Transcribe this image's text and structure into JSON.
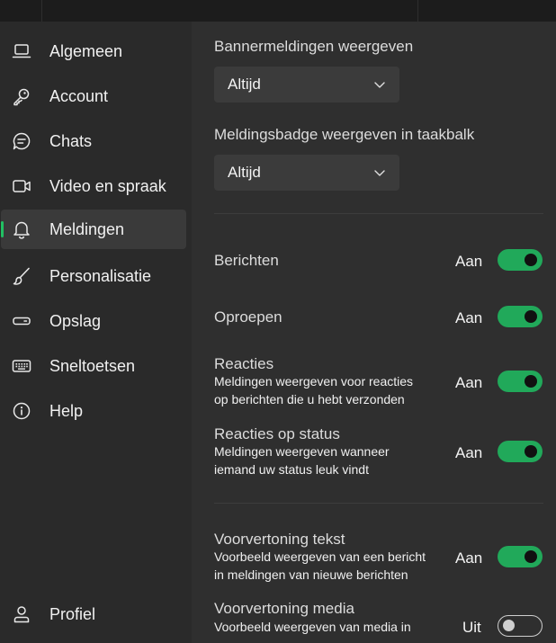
{
  "sidebar": {
    "items": [
      {
        "label": "Algemeen",
        "icon": "laptop-icon"
      },
      {
        "label": "Account",
        "icon": "key-icon"
      },
      {
        "label": "Chats",
        "icon": "chat-icon"
      },
      {
        "label": "Video en spraak",
        "icon": "video-icon"
      },
      {
        "label": "Meldingen",
        "icon": "bell-icon",
        "active": true
      },
      {
        "label": "Personalisatie",
        "icon": "brush-icon"
      },
      {
        "label": "Opslag",
        "icon": "storage-icon"
      },
      {
        "label": "Sneltoetsen",
        "icon": "keyboard-icon"
      },
      {
        "label": "Help",
        "icon": "info-icon"
      }
    ],
    "profile": {
      "label": "Profiel",
      "icon": "profile-icon"
    }
  },
  "main": {
    "banner": {
      "title": "Bannermeldingen weergeven",
      "value": "Altijd"
    },
    "badge": {
      "title": "Meldingsbadge weergeven in taakbalk",
      "value": "Altijd"
    },
    "settings": [
      {
        "title": "Berichten",
        "state": "Aan",
        "on": true
      },
      {
        "title": "Oproepen",
        "state": "Aan",
        "on": true
      },
      {
        "title": "Reacties",
        "desc1": "Meldingen weergeven voor reacties",
        "desc2": "op berichten die u hebt verzonden",
        "state": "Aan",
        "on": true
      },
      {
        "title": "Reacties op status",
        "desc1": "Meldingen weergeven wanneer",
        "desc2": "iemand uw status leuk vindt",
        "state": "Aan",
        "on": true
      },
      {
        "title": "Voorvertoning tekst",
        "desc1": "Voorbeeld weergeven van een bericht",
        "desc2": "in meldingen van nieuwe berichten",
        "state": "Aan",
        "on": true
      },
      {
        "title": "Voorvertoning media",
        "desc1": "Voorbeeld weergeven van media in",
        "state": "Uit",
        "on": false
      }
    ]
  },
  "colors": {
    "accent": "#21c063",
    "toggle_on": "#21a95a"
  }
}
